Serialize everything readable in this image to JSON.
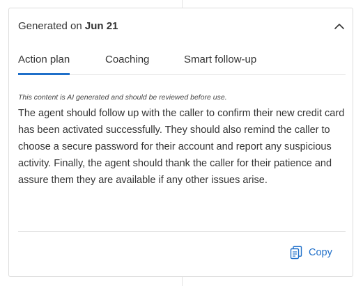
{
  "header": {
    "generated_prefix": "Generated on",
    "generated_date": "Jun 21",
    "collapse_icon": "chevron-up-icon"
  },
  "tabs": [
    {
      "label": "Action plan",
      "active": true
    },
    {
      "label": "Coaching",
      "active": false
    },
    {
      "label": "Smart follow-up",
      "active": false
    }
  ],
  "content": {
    "disclaimer": "This content is AI generated and should be reviewed before use.",
    "body": "The agent should follow up with the caller to confirm their new credit card has been activated successfully. They should also remind the caller to choose a secure password for their account and report any suspicious activity. Finally, the agent should thank the caller for their patience and assure them they are available if any other issues arise."
  },
  "footer": {
    "copy_label": "Copy",
    "copy_icon": "copy-icon"
  },
  "colors": {
    "accent": "#1f6fc9",
    "text": "#333333",
    "border": "#dcdcdc"
  }
}
